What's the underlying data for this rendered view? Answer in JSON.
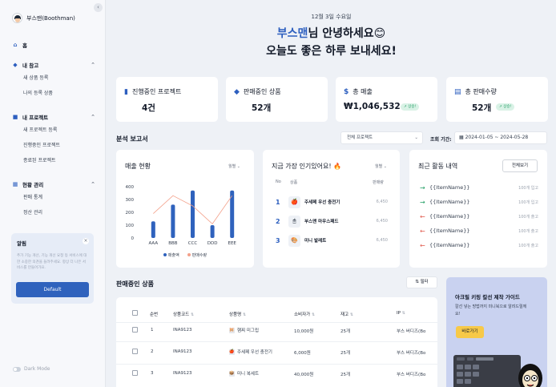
{
  "sidebar": {
    "collapse_icon": "chevron-left-icon",
    "brand": "부스맨(Boothman)",
    "home": "홈",
    "sections": [
      {
        "label": "내 참고",
        "icon": "tag-icon",
        "items": [
          "새 상품 등록",
          "나의 등록 상품"
        ]
      },
      {
        "label": "내 프로젝트",
        "icon": "folder-icon",
        "items": [
          "새 프로젝트 등록",
          "진행중인 프로젝트",
          "종료된 프로젝트"
        ]
      },
      {
        "label": "현황 관리",
        "icon": "chart-icon",
        "items": [
          "판매 통계",
          "정산 관리"
        ]
      }
    ],
    "alert": {
      "title": "알림",
      "text": "추가 기능 개선, 기능 개선 요청 등 서비스에 대한 소중한 의견을 들려주세요. 항상 더 나은 서비스를 만들어가요.",
      "button": "Default"
    },
    "dark_mode": "Dark Mode"
  },
  "header": {
    "date": "12월 3일 수요일",
    "greeting_name": "부스맨",
    "greeting_rest": "님 안녕하세요😊",
    "greeting_line2": "오늘도 좋은 하루 보내세요!"
  },
  "stats": [
    {
      "label": "진행중인 프로젝트",
      "value": "4건",
      "badge": ""
    },
    {
      "label": "판매중인 상품",
      "value": "52개",
      "badge": ""
    },
    {
      "label": "총 매출",
      "value": "₩1,046,532",
      "badge": "↗ 상승!"
    },
    {
      "label": "총 판매수량",
      "value": "52개",
      "badge": "↗ 상승!"
    }
  ],
  "analysis": {
    "title": "분석 보고서",
    "project_select": "전체 프로젝트",
    "period_label": "조회 기간:",
    "date_from": "2024-01-05",
    "date_sep": "~",
    "date_to": "2024-05-28"
  },
  "sales_panel": {
    "title": "매출 현황",
    "period": "월별",
    "legend_bar": "매출액",
    "legend_line": "판매수량"
  },
  "chart_data": {
    "type": "bar",
    "categories": [
      "AAA",
      "BBB",
      "CCC",
      "DDD",
      "EEE"
    ],
    "series": [
      {
        "name": "매출액",
        "type": "bar",
        "values": [
          130,
          260,
          370,
          100,
          370
        ],
        "color": "#2f62bd"
      },
      {
        "name": "판매수량",
        "type": "line",
        "values": [
          190,
          330,
          250,
          110,
          330
        ],
        "color": "#f3a08a"
      }
    ],
    "yticks": [
      0,
      100,
      200,
      300,
      400
    ],
    "ylim": [
      0,
      400
    ]
  },
  "popular": {
    "title": "지금 가장 인기있어요! 🔥",
    "period": "월별",
    "headers": {
      "no": "No",
      "product": "상품",
      "sales": "판매량"
    },
    "items": [
      {
        "rank": "1",
        "name": "주세페 우선 충전기",
        "sales": "6,450",
        "icon": "🍎"
      },
      {
        "rank": "2",
        "name": "부스맨 마우스패드",
        "sales": "6,450",
        "icon": "🖱"
      },
      {
        "rank": "3",
        "name": "미니 발레트",
        "sales": "6,450",
        "icon": "🎨"
      }
    ]
  },
  "activity": {
    "title": "최근 활동 내역",
    "button": "전체보기",
    "items": [
      {
        "name": "{{ItemName}}",
        "qty": "100개 입고",
        "dir": "in"
      },
      {
        "name": "{{ItemName}}",
        "qty": "100개 입고",
        "dir": "in"
      },
      {
        "name": "{{ItemName}}",
        "qty": "100개 출고",
        "dir": "out"
      },
      {
        "name": "{{ItemName}}",
        "qty": "100개 출고",
        "dir": "out"
      },
      {
        "name": "{{ItemName}}",
        "qty": "100개 출고",
        "dir": "out"
      }
    ]
  },
  "products": {
    "title": "판매중인 상품",
    "filter": "필터",
    "columns": [
      "순번",
      "상품코드",
      "상품명",
      "소비자가",
      "재고",
      "IP"
    ],
    "rows": [
      {
        "no": "1",
        "code": "INA9123",
        "name": "햄찌 미그립",
        "price": "10,000원",
        "stock": "25개",
        "ip": "부스 버디즈(Bo",
        "icon": "🐹"
      },
      {
        "no": "2",
        "code": "INA9123",
        "name": "주세페 우선 충전기",
        "price": "6,000원",
        "stock": "25개",
        "ip": "부스 버디즈(Bo",
        "icon": "🍎"
      },
      {
        "no": "3",
        "code": "INA9123",
        "name": "미니 복세트",
        "price": "40,000원",
        "stock": "25개",
        "ip": "부스 버디즈(Bo",
        "icon": "📦"
      }
    ]
  },
  "promo": {
    "title": "아크릴 키링 칼선 제작 가이드",
    "text": "칼선 넣는 방법까지 미니북으로 알려드릴께요!",
    "button": "바로가기"
  }
}
